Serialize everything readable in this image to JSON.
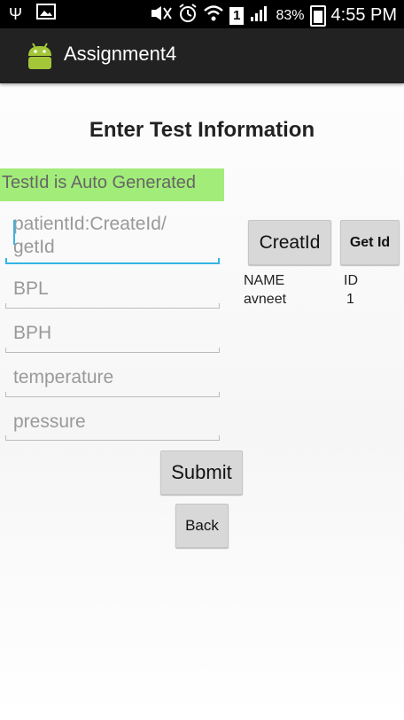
{
  "status_bar": {
    "battery_percent": "83%",
    "sim_slot": "1",
    "time": "4:55 PM"
  },
  "action_bar": {
    "title": "Assignment4"
  },
  "page": {
    "title": "Enter Test Information",
    "banner": "TestId is Auto Generated"
  },
  "form": {
    "patient_id_placeholder": "patientId:CreateId/\ngetId",
    "bpl_placeholder": "BPL",
    "bph_placeholder": "BPH",
    "temperature_placeholder": "temperature",
    "pressure_placeholder": "pressure",
    "submit_label": "Submit",
    "back_label": "Back"
  },
  "side": {
    "create_id_label": "CreatId",
    "get_id_label": "Get Id",
    "table": {
      "headers": [
        "NAME",
        "ID"
      ],
      "rows": [
        [
          "avneet",
          "1"
        ]
      ]
    }
  }
}
